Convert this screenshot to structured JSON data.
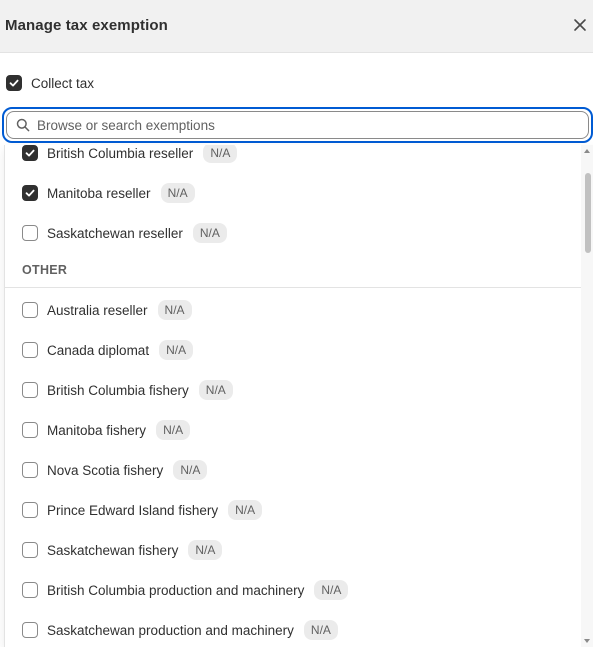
{
  "modal": {
    "title": "Manage tax exemption",
    "close_icon": "close-icon"
  },
  "collect_tax": {
    "label": "Collect tax",
    "checked": true
  },
  "search": {
    "placeholder": "Browse or search exemptions",
    "value": "",
    "icon": "search-icon"
  },
  "dropdown": {
    "group_options": [
      {
        "label": "British Columbia reseller",
        "badge": "N/A",
        "checked": true
      },
      {
        "label": "Manitoba reseller",
        "badge": "N/A",
        "checked": true
      },
      {
        "label": "Saskatchewan reseller",
        "badge": "N/A",
        "checked": false
      }
    ],
    "other_section": {
      "title": "OTHER",
      "options": [
        {
          "label": "Australia reseller",
          "badge": "N/A",
          "checked": false
        },
        {
          "label": "Canada diplomat",
          "badge": "N/A",
          "checked": false
        },
        {
          "label": "British Columbia fishery",
          "badge": "N/A",
          "checked": false
        },
        {
          "label": "Manitoba fishery",
          "badge": "N/A",
          "checked": false
        },
        {
          "label": "Nova Scotia fishery",
          "badge": "N/A",
          "checked": false
        },
        {
          "label": "Prince Edward Island fishery",
          "badge": "N/A",
          "checked": false
        },
        {
          "label": "Saskatchewan fishery",
          "badge": "N/A",
          "checked": false
        },
        {
          "label": "British Columbia production and machinery",
          "badge": "N/A",
          "checked": false
        },
        {
          "label": "Saskatchewan production and machinery",
          "badge": "N/A",
          "checked": false
        }
      ]
    }
  },
  "colors": {
    "accent_focus": "#005bd3",
    "checkbox_checked": "#303030",
    "badge_bg": "#ebebeb"
  }
}
